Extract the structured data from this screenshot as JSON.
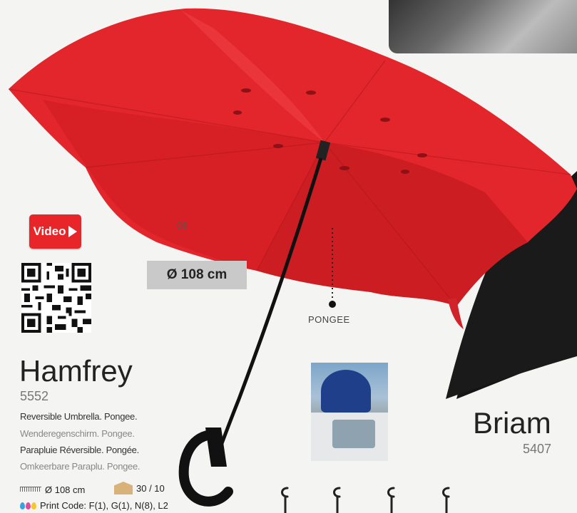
{
  "video": {
    "label": "Video"
  },
  "diameter_badge": "Ø 108 cm",
  "variant_code": "03",
  "material_label": "PONGEE",
  "product": {
    "name": "Hamfrey",
    "ref": "5552",
    "descriptions": [
      "Reversible Umbrella. Pongee.",
      "Wenderegenschirm. Pongee.",
      "Parapluie Réversible. Pongée.",
      "Omkeerbare Paraplu. Pongee."
    ],
    "diameter_spec": "Ø 108 cm",
    "packaging": "30 / 10",
    "print_code": "Print Code: F(1), G(1), N(8), L2"
  },
  "related": {
    "name": "Briam",
    "ref": "5407"
  },
  "colors": {
    "canopy": "#e2262b",
    "canopy_dark": "#b81a1f",
    "black_umbrella": "#151515",
    "video": "#e8262a"
  }
}
